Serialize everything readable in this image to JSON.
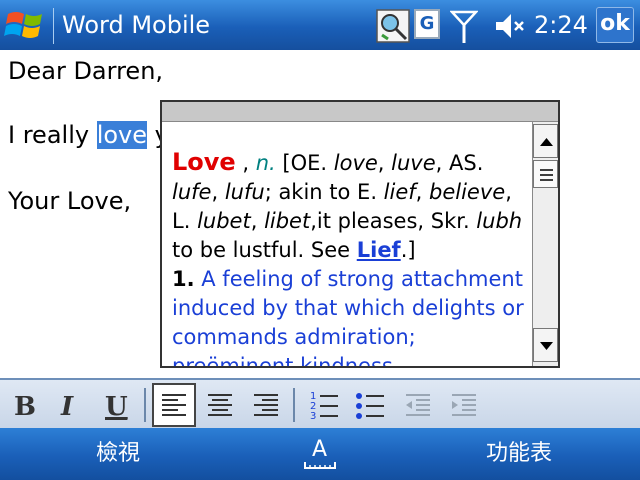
{
  "titlebar": {
    "app_title": "Word Mobile",
    "clock": "2:24",
    "ok_label": "ok",
    "g_label": "G",
    "icons": [
      "windows-start-icon",
      "sync-icon",
      "g-icon",
      "signal-icon",
      "volume-icon"
    ]
  },
  "document": {
    "line1": "Dear Darren,",
    "line2_before": "I really ",
    "line2_selected": "love",
    "line2_after": " you",
    "line3": "Your Love,"
  },
  "dictionary": {
    "headword": "Love",
    "comma": " , ",
    "pos": "n.",
    "etym_1": " [OE. ",
    "love": "love",
    "c1": ", ",
    "luve": "luve",
    "as": ", AS. ",
    "lufe": "lufe",
    "c2": ", ",
    "lufu": "lufu",
    "akin": "; akin to E. ",
    "lief": "lief",
    "c3": ", ",
    "believe": "believe",
    "c4": ", ",
    "l": "L. ",
    "lubet": "lubet",
    "c5": ", ",
    "libet": "libet",
    "pleases": ",it pleases, Skr. ",
    "lubh": "lubh",
    "lustful": "to be lustful. See ",
    "link": "Lief",
    "end": ".]",
    "sense_num": "1.",
    "sense_text": " A feeling of strong attachment induced by that which delights or commands admiration; preëminent kindness"
  },
  "softkeys": {
    "left": "檢視",
    "right": "功能表"
  },
  "colors": {
    "title_bar": "#1a5fb8",
    "selection": "#3a7fd8",
    "headword": "#e00000",
    "link": "#1a3fd6",
    "pos": "#008080"
  }
}
